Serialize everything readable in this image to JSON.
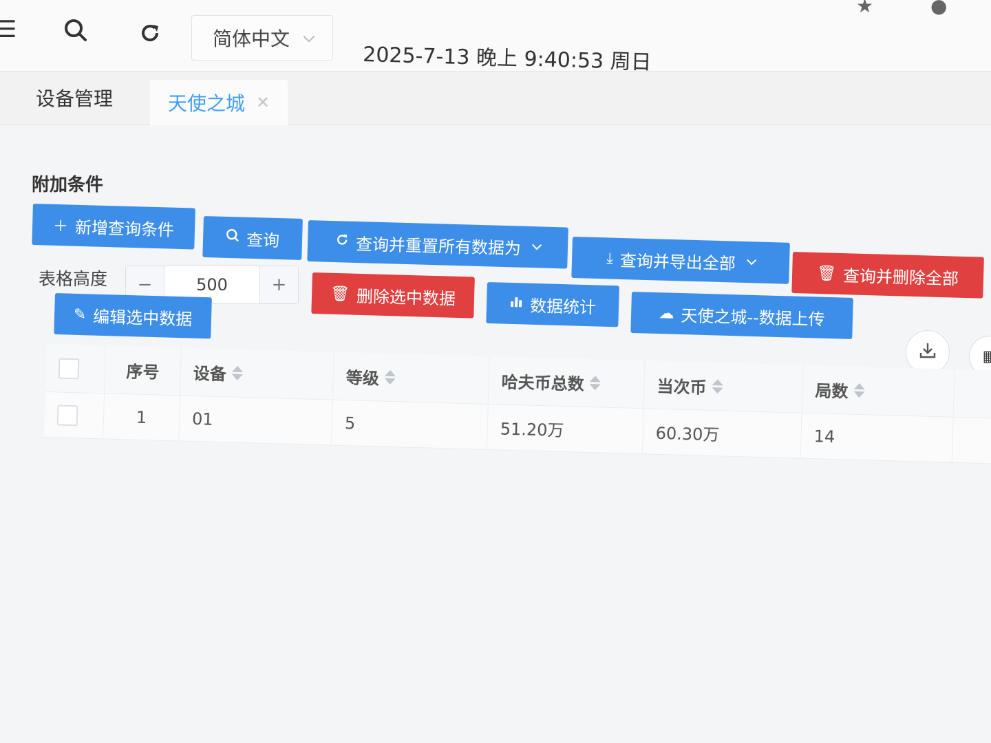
{
  "topbar": {
    "language": "简体中文",
    "datetime": "2025-7-13 晚上 9:40:53 周日"
  },
  "tabs": [
    {
      "label": "设备管理",
      "active": false
    },
    {
      "label": "天使之城",
      "active": true
    }
  ],
  "section_title": "附加条件",
  "buttons": {
    "add_condition": "新增查询条件",
    "query": "查询",
    "query_reset": "查询并重置所有数据为",
    "query_export": "查询并导出全部",
    "query_delete_all": "查询并删除全部",
    "delete_selected": "删除选中数据",
    "statistics": "数据统计",
    "upload": "天使之城--数据上传",
    "edit_selected": "编辑选中数据"
  },
  "table_height": {
    "label": "表格高度",
    "value": "500"
  },
  "table": {
    "columns": [
      "序号",
      "设备",
      "等级",
      "哈夫币总数",
      "当次币",
      "局数"
    ],
    "rows": [
      {
        "index": "1",
        "device": "01",
        "level": "5",
        "total_coins": "51.20万",
        "current_coins": "60.30万",
        "rounds": "14"
      }
    ]
  },
  "colors": {
    "primary": "#3d8ee9",
    "danger": "#e0403f",
    "tab_active": "#409eff"
  },
  "icons": [
    "menu-icon",
    "search-icon",
    "refresh-icon",
    "chevron-down-icon",
    "plus-icon",
    "trash-icon",
    "edit-icon",
    "bar-chart-icon",
    "cloud-upload-icon",
    "download-icon",
    "columns-icon"
  ]
}
